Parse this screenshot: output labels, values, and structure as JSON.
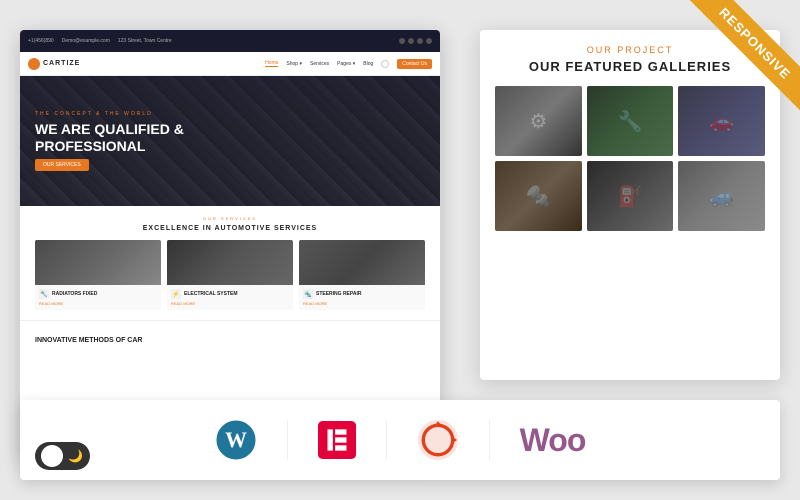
{
  "badge": {
    "text": "RESPONSIVE"
  },
  "website": {
    "header": {
      "phone": "+1(456)890",
      "email": "Demo@example.com",
      "address": "123 Street, Town Centre"
    },
    "nav": {
      "logo": "CARTIZE",
      "links": [
        "Home",
        "Shop",
        "Services",
        "Pages",
        "Blog"
      ],
      "active": "Home",
      "contact_btn": "Contact Us"
    },
    "hero": {
      "subtitle": "THE CONCEPT & THE WORLD",
      "title_line1": "WE ARE QUALIFIED &",
      "title_line2": "PROFESSIONAL",
      "cta": "OUR SERVICES"
    },
    "services": {
      "subtitle": "OUR SERVICES",
      "title": "EXCELLENCE IN AUTOMOTIVE SERVICES",
      "items": [
        {
          "name": "RADIATORS FIXED",
          "read_more": "READ MORE"
        },
        {
          "name": "ELECTRICAL SYSTEM",
          "read_more": "READ MORE"
        },
        {
          "name": "STEERING REPAIR",
          "read_more": "READ MORE"
        }
      ]
    },
    "bottom": {
      "title": "INNOVATIVE METHODS OF CAR"
    }
  },
  "gallery": {
    "subtitle": "OUR PROJECT",
    "title": "OUR FEATURED GALLERIES",
    "images": [
      "tire",
      "engine-oil",
      "car-side",
      "engine-hood",
      "oil-change",
      "luxury-car"
    ]
  },
  "plugins": {
    "wordpress": {
      "label": "WordPress",
      "color": "#21759b"
    },
    "elementor": {
      "label": "Elementor",
      "color": "#e2003b"
    },
    "woocommerce_icon": {
      "label": "WooCommerce Refresh",
      "color": "#e2401c"
    },
    "woo_text": "Woo",
    "woo_color": "#96588a"
  },
  "toggle": {
    "label": "dark mode toggle",
    "moon_icon": "🌙"
  }
}
